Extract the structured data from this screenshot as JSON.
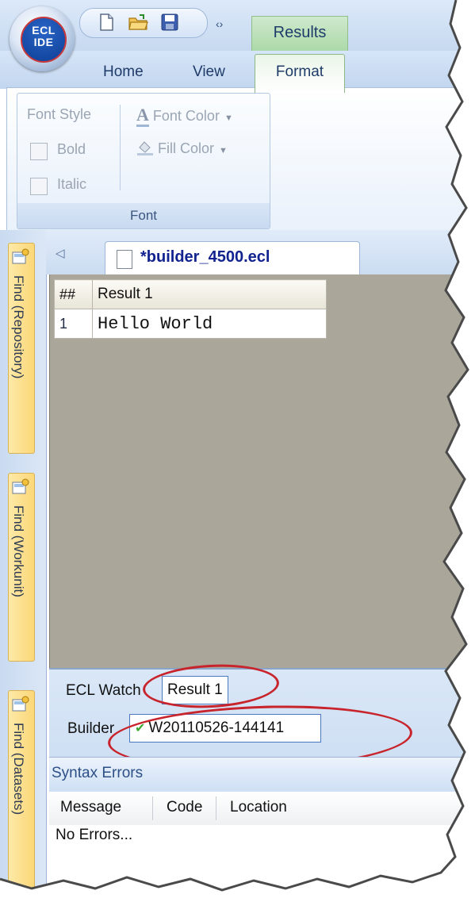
{
  "app": {
    "logo_text": "ECL IDE",
    "logo_line1": "ECL",
    "logo_line2": "IDE"
  },
  "quick_access": {
    "buttons": [
      "new-document-icon",
      "open-folder-icon",
      "save-disk-icon"
    ],
    "overflow_label": "‹›"
  },
  "context_tab": {
    "label": "Results",
    "color": "#a9d8a6"
  },
  "ribbon_tabs": [
    {
      "label": "Home"
    },
    {
      "label": "View"
    },
    {
      "label": "Format",
      "active": true
    }
  ],
  "ribbon": {
    "group_label": "Font",
    "font_style_label": "Font Style",
    "bold_label": "Bold",
    "italic_label": "Italic",
    "font_color_label": "Font Color",
    "fill_color_label": "Fill Color"
  },
  "left_dock": {
    "tabs": [
      {
        "label": "Find (Repository)"
      },
      {
        "label": "Find (Workunit)"
      },
      {
        "label": "Find (Datasets)"
      }
    ]
  },
  "document": {
    "tab_title": "*builder_4500.ecl",
    "nav_arrow": "◁"
  },
  "results_grid": {
    "headers": [
      "##",
      "Result 1"
    ],
    "rows": [
      {
        "num": "1",
        "value": "Hello World"
      }
    ],
    "background": "#aaa79a"
  },
  "watch": {
    "ecl_watch_label": "ECL Watch",
    "ecl_watch_value": "Result 1",
    "builder_label": "Builder",
    "builder_value": "W20110526-144141",
    "annotation_color": "#c8242c"
  },
  "syntax_errors": {
    "title": "Syntax Errors",
    "columns": [
      "Message",
      "Code",
      "Location"
    ],
    "message": "No Errors..."
  }
}
